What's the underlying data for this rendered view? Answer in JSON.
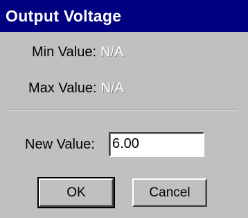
{
  "window": {
    "title": "Output Voltage"
  },
  "fields": {
    "min_label": "Min Value:",
    "min_value": "N/A",
    "max_label": "Max Value:",
    "max_value": "N/A",
    "new_label": "New Value:",
    "new_value": "6.00"
  },
  "buttons": {
    "ok_label": "OK",
    "cancel_label": "Cancel"
  },
  "colors": {
    "titlebar": "#000080",
    "dialog_bg": "#c0c0c0"
  }
}
